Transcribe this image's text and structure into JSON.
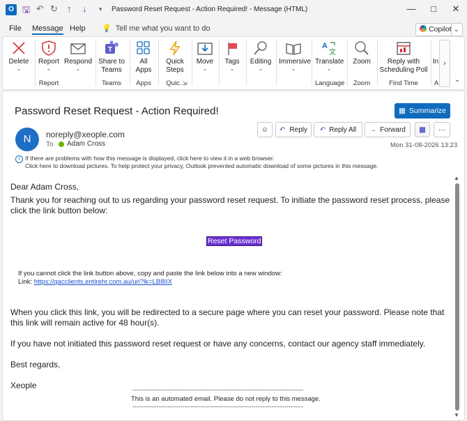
{
  "window": {
    "title": "Password Reset Request - Action Required!  -  Message (HTML)",
    "app_icon": "outlook-icon"
  },
  "menubar": {
    "items": [
      "File",
      "Message",
      "Help"
    ],
    "active": "Message",
    "tell_me": "Tell me what you want to do",
    "copilot": "Copilot"
  },
  "ribbon": {
    "buttons": [
      {
        "label": "Delete",
        "icon": "delete-icon"
      },
      {
        "label": "Report",
        "icon": "report-shield-icon"
      },
      {
        "label": "Respond",
        "icon": "respond-envelope-icon"
      },
      {
        "label": "Share to Teams",
        "icon": "teams-icon"
      },
      {
        "label": "All Apps",
        "icon": "apps-grid-icon"
      },
      {
        "label": "Quick Steps",
        "icon": "lightning-icon"
      },
      {
        "label": "Move",
        "icon": "move-folder-icon"
      },
      {
        "label": "Tags",
        "icon": "flag-icon"
      },
      {
        "label": "Editing",
        "icon": "search-edit-icon"
      },
      {
        "label": "Immersive",
        "icon": "immersive-reader-icon"
      },
      {
        "label": "Translate",
        "icon": "translate-icon"
      },
      {
        "label": "Zoom",
        "icon": "zoom-icon"
      },
      {
        "label": "Reply with Scheduling Poll",
        "icon": "scheduling-poll-icon"
      },
      {
        "label": "In",
        "icon": "insights-icon"
      }
    ],
    "groups": [
      "Report",
      "Teams",
      "Apps",
      "Quic...",
      "Language",
      "Zoom",
      "Find Time",
      "A"
    ]
  },
  "message": {
    "subject": "Password Reset Request - Action Required!",
    "summarize": "Summarize",
    "avatar_initial": "N",
    "sender": "noreply@xeople.com",
    "to_label": "To",
    "to_name": "Adam Cross",
    "date": "Mon 31-08-2026 13:23",
    "actions": {
      "reply": "Reply",
      "reply_all": "Reply All",
      "forward": "Forward",
      "more": "···"
    },
    "info_line1": "If there are problems with how this message is displayed, click here to view it in a web browser.",
    "info_line2": "Click here to download pictures. To help protect your privacy, Outlook prevented automatic download of some pictures in this message."
  },
  "body": {
    "greeting": "Dear Adam Cross,",
    "intro": "Thank you for reaching out to us regarding your password reset request. To initiate the password reset process, please click the link button below:",
    "button": "Reset Password",
    "fallback": "If you cannot click the link button above, copy and paste the link below into a new window:",
    "link_label": "Link:",
    "link_url": "https://qacclients.entirehr.com.au/uri?lk=LB8IIX",
    "after": "When you click this link, you will be redirected to a secure page where you can reset your password. Please note that this link will remain active for 48 hour(s).",
    "concern": "If you have not initiated this password reset request or have any concerns, contact our agency staff immediately.",
    "regards": "Best regards,",
    "signoff": "Xeople",
    "footer_dashes": "--------------------------------------------------------------------------------------------",
    "footer": "This is an automated email. Please do not reply to this message."
  }
}
